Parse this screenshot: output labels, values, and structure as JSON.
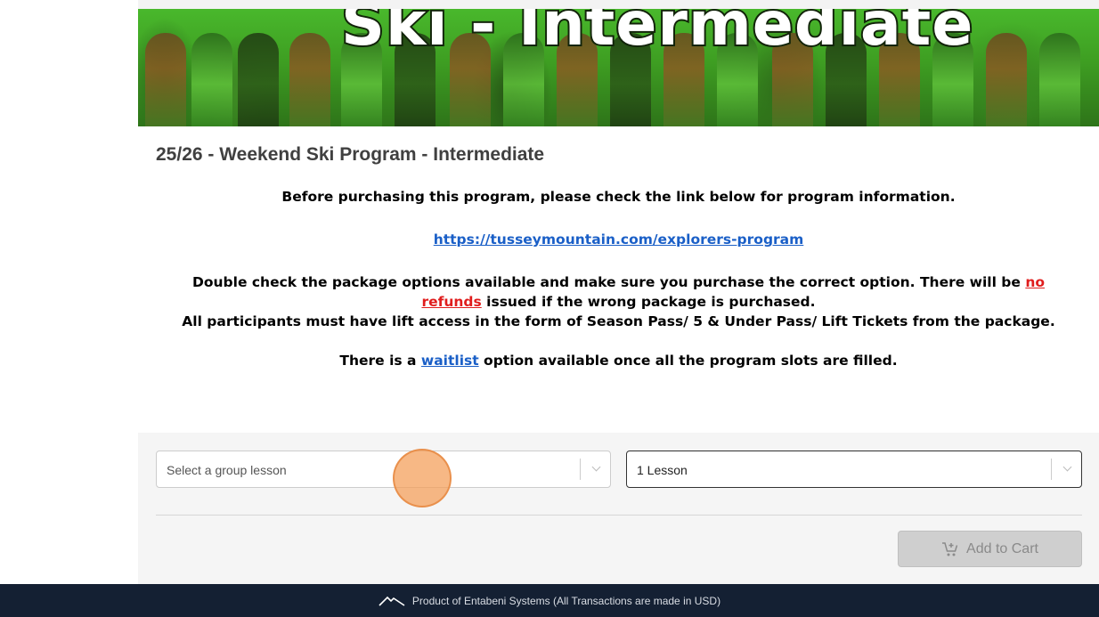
{
  "banner": {
    "title": "Ski - Intermediate"
  },
  "program": {
    "title": "25/26 - Weekend Ski Program - Intermediate",
    "intro": "Before purchasing this program, please check the link below for program information.",
    "info_link": "https://tusseymountain.com/explorers-program",
    "warning_part1": "Double check the package options available and make sure you purchase the correct option. There will be",
    "warning_link": "no refunds",
    "warning_part2": "issued if the wrong package is purchased.",
    "lift_access": "All participants must have lift access in the form of Season Pass/ 5 & Under Pass/ Lift Tickets from the package.",
    "waitlist_part1": "There is a",
    "waitlist_link": "waitlist",
    "waitlist_part2": "option available once all the program slots are filled."
  },
  "purchase": {
    "group_lesson_placeholder": "Select a group lesson",
    "lesson_count_value": "1 Lesson",
    "add_to_cart_label": "Add to Cart"
  },
  "footer": {
    "text": "Product of Entabeni Systems (All Transactions are made in USD)"
  },
  "colors": {
    "footer_bg": "#142033",
    "link": "#1a5fc7",
    "warning": "#e01d1d",
    "banner_green": "#3e9e22"
  },
  "icons": [
    "cart-plus-icon",
    "chevron-down-icon",
    "mountain-logo-icon"
  ]
}
